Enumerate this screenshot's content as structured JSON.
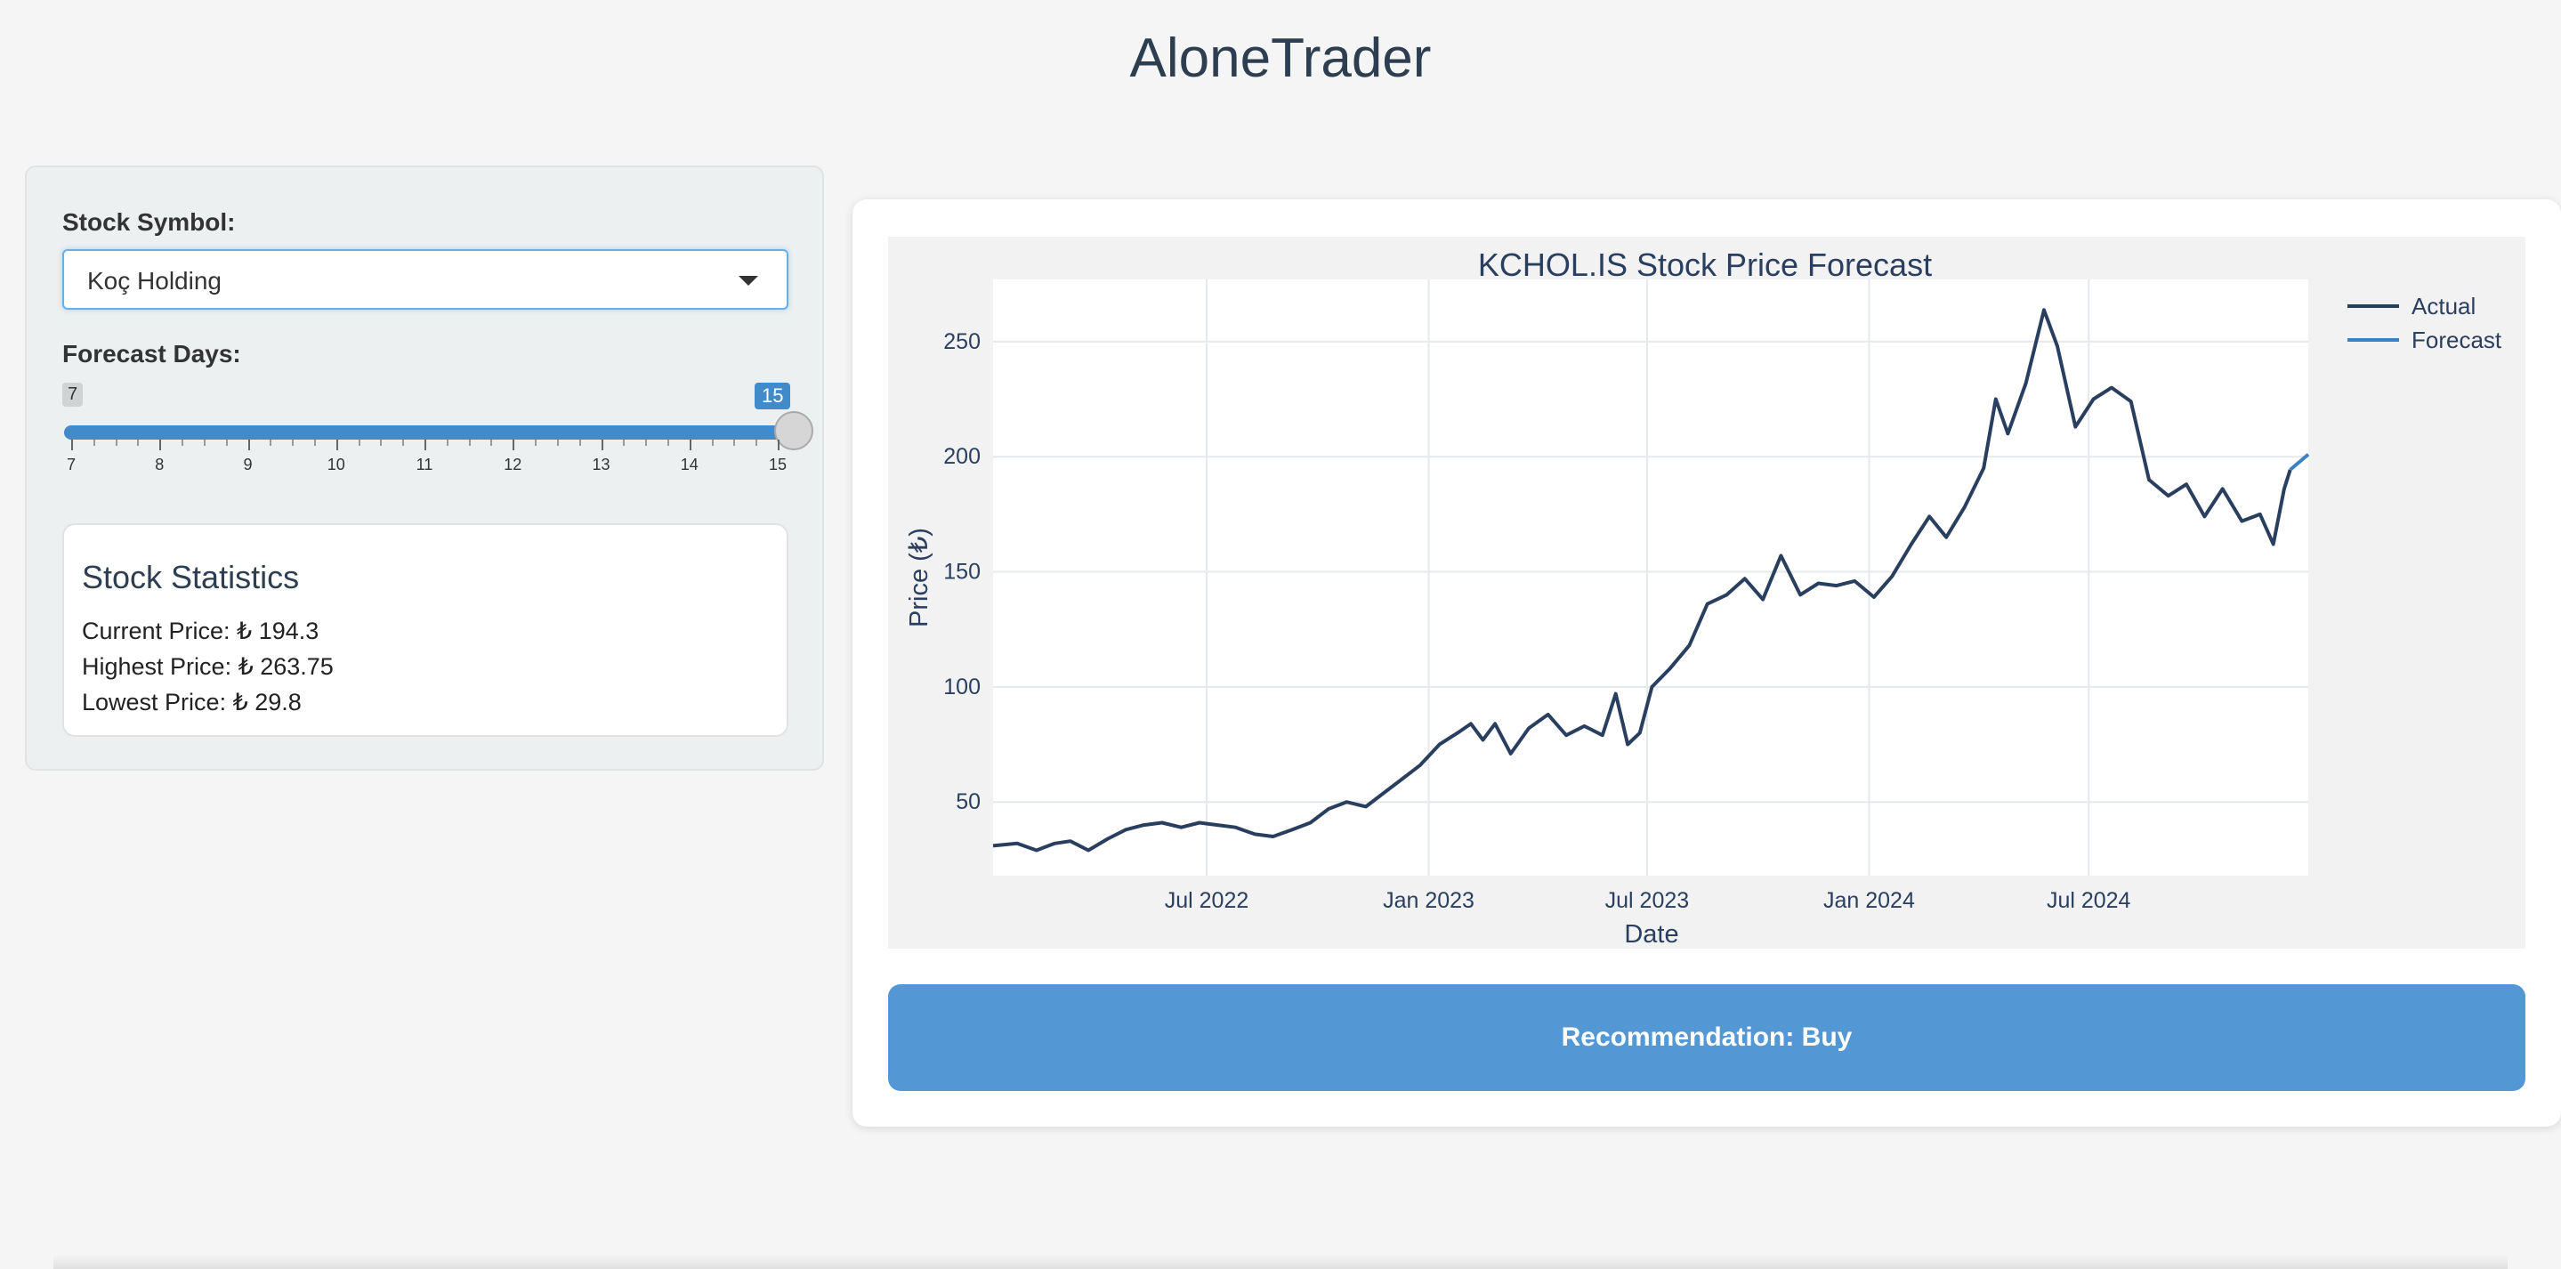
{
  "app": {
    "title": "AloneTrader"
  },
  "sidebar": {
    "symbol_label": "Stock Symbol:",
    "symbol_value": "Koç Holding",
    "forecast_label": "Forecast Days:",
    "slider": {
      "min": 7,
      "max": 15,
      "value": 15,
      "min_label": "7",
      "value_label": "15",
      "ticks": [
        "7",
        "8",
        "9",
        "10",
        "11",
        "12",
        "13",
        "14",
        "15"
      ]
    }
  },
  "stats": {
    "title": "Stock Statistics",
    "current": "Current Price: ₺ 194.3",
    "highest": "Highest Price: ₺ 263.75",
    "lowest": "Lowest Price: ₺ 29.8"
  },
  "recommendation": {
    "label": "Recommendation: Buy"
  },
  "colors": {
    "actual": "#2a3f5f",
    "forecast": "#3b82c4",
    "button": "#5398d4",
    "accent": "#428bca"
  },
  "chart_data": {
    "type": "line",
    "title": "KCHOL.IS Stock Price Forecast",
    "xlabel": "Date",
    "ylabel": "Price (₺)",
    "x_ticks": [
      {
        "label": "Jul 2022",
        "date": "2022-07-01"
      },
      {
        "label": "Jan 2023",
        "date": "2023-01-01"
      },
      {
        "label": "Jul 2023",
        "date": "2023-07-01"
      },
      {
        "label": "Jan 2024",
        "date": "2024-01-01"
      },
      {
        "label": "Jul 2024",
        "date": "2024-07-01"
      }
    ],
    "y_ticks": [
      50,
      100,
      150,
      200,
      250
    ],
    "xlim": [
      "2022-01-05",
      "2024-12-30"
    ],
    "ylim": [
      18,
      277
    ],
    "legend": "top-right",
    "grid": true,
    "series": [
      {
        "name": "Actual",
        "color": "#2a3f5f",
        "points": [
          [
            "2022-01-05",
            31
          ],
          [
            "2022-01-25",
            32
          ],
          [
            "2022-02-10",
            29
          ],
          [
            "2022-02-25",
            32
          ],
          [
            "2022-03-10",
            33
          ],
          [
            "2022-03-25",
            29
          ],
          [
            "2022-04-10",
            34
          ],
          [
            "2022-04-25",
            38
          ],
          [
            "2022-05-10",
            40
          ],
          [
            "2022-05-25",
            41
          ],
          [
            "2022-06-10",
            39
          ],
          [
            "2022-06-25",
            41
          ],
          [
            "2022-07-10",
            40
          ],
          [
            "2022-07-25",
            39
          ],
          [
            "2022-08-10",
            36
          ],
          [
            "2022-08-25",
            35
          ],
          [
            "2022-09-10",
            38
          ],
          [
            "2022-09-25",
            41
          ],
          [
            "2022-10-10",
            47
          ],
          [
            "2022-10-25",
            50
          ],
          [
            "2022-11-10",
            48
          ],
          [
            "2022-11-25",
            54
          ],
          [
            "2022-12-10",
            60
          ],
          [
            "2022-12-25",
            66
          ],
          [
            "2023-01-10",
            75
          ],
          [
            "2023-01-25",
            80
          ],
          [
            "2023-02-05",
            84
          ],
          [
            "2023-02-15",
            77
          ],
          [
            "2023-02-25",
            84
          ],
          [
            "2023-03-10",
            71
          ],
          [
            "2023-03-25",
            82
          ],
          [
            "2023-04-10",
            88
          ],
          [
            "2023-04-25",
            79
          ],
          [
            "2023-05-10",
            83
          ],
          [
            "2023-05-25",
            79
          ],
          [
            "2023-06-05",
            97
          ],
          [
            "2023-06-15",
            75
          ],
          [
            "2023-06-25",
            80
          ],
          [
            "2023-07-05",
            100
          ],
          [
            "2023-07-20",
            108
          ],
          [
            "2023-08-05",
            118
          ],
          [
            "2023-08-20",
            136
          ],
          [
            "2023-09-05",
            140
          ],
          [
            "2023-09-20",
            147
          ],
          [
            "2023-10-05",
            138
          ],
          [
            "2023-10-20",
            157
          ],
          [
            "2023-11-05",
            140
          ],
          [
            "2023-11-20",
            145
          ],
          [
            "2023-12-05",
            144
          ],
          [
            "2023-12-20",
            146
          ],
          [
            "2024-01-05",
            139
          ],
          [
            "2024-01-20",
            148
          ],
          [
            "2024-02-05",
            162
          ],
          [
            "2024-02-20",
            174
          ],
          [
            "2024-03-05",
            165
          ],
          [
            "2024-03-20",
            178
          ],
          [
            "2024-04-05",
            195
          ],
          [
            "2024-04-15",
            225
          ],
          [
            "2024-04-25",
            210
          ],
          [
            "2024-05-10",
            232
          ],
          [
            "2024-05-25",
            263.75
          ],
          [
            "2024-06-05",
            248
          ],
          [
            "2024-06-20",
            213
          ],
          [
            "2024-07-05",
            225
          ],
          [
            "2024-07-20",
            230
          ],
          [
            "2024-08-05",
            224
          ],
          [
            "2024-08-20",
            190
          ],
          [
            "2024-09-05",
            183
          ],
          [
            "2024-09-20",
            188
          ],
          [
            "2024-10-05",
            174
          ],
          [
            "2024-10-20",
            186
          ],
          [
            "2024-11-05",
            172
          ],
          [
            "2024-11-20",
            175
          ],
          [
            "2024-12-01",
            162
          ],
          [
            "2024-12-10",
            186
          ],
          [
            "2024-12-15",
            194.3
          ]
        ]
      },
      {
        "name": "Forecast",
        "color": "#3b82c4",
        "points": [
          [
            "2024-12-15",
            194.3
          ],
          [
            "2024-12-30",
            201
          ]
        ]
      }
    ]
  }
}
